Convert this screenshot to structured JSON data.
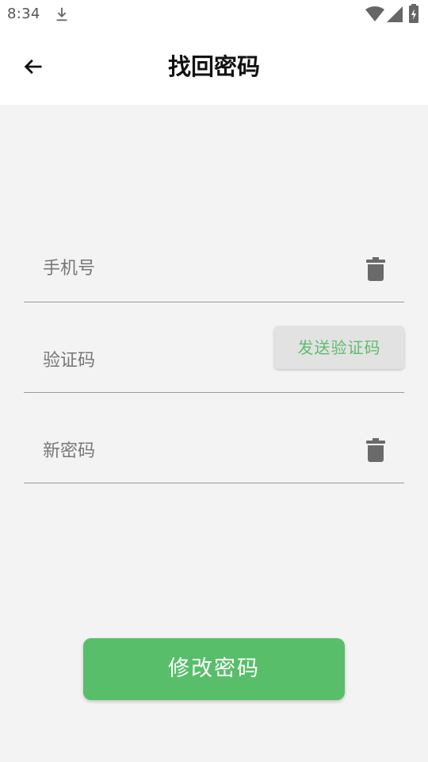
{
  "status_bar": {
    "time": "8:34",
    "icons": [
      "download-icon",
      "wifi-icon",
      "cell-signal-icon",
      "battery-charging-icon"
    ]
  },
  "app_bar": {
    "title": "找回密码",
    "back_icon": "arrow-left-icon"
  },
  "form": {
    "phone": {
      "placeholder": "手机号",
      "value": "",
      "clear_icon": "trash-icon"
    },
    "code": {
      "placeholder": "验证码",
      "value": "",
      "send_button_label": "发送验证码"
    },
    "new_password": {
      "placeholder": "新密码",
      "value": "",
      "clear_icon": "trash-icon"
    }
  },
  "submit_button_label": "修改密码",
  "colors": {
    "accent": "#58be6a",
    "send_code_text": "#5cbd6c",
    "background": "#f3f3f3",
    "app_bar": "#ffffff"
  }
}
